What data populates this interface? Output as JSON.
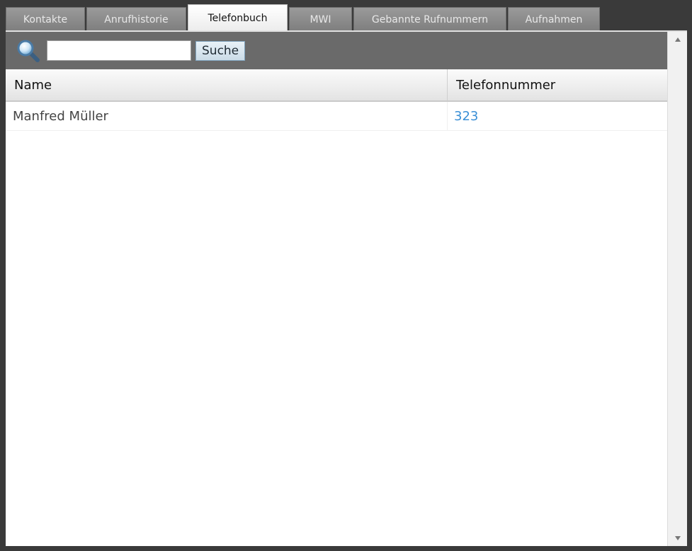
{
  "tabs": [
    {
      "label": "Kontakte",
      "active": false
    },
    {
      "label": "Anrufhistorie",
      "active": false
    },
    {
      "label": "Telefonbuch",
      "active": true
    },
    {
      "label": "MWI",
      "active": false
    },
    {
      "label": "Gebannte Rufnummern",
      "active": false
    },
    {
      "label": "Aufnahmen",
      "active": false
    }
  ],
  "toolbar": {
    "search_icon": "search-icon",
    "search_value": "",
    "search_button_label": "Suche"
  },
  "table": {
    "headers": {
      "name": "Name",
      "phone": "Telefonnummer"
    },
    "rows": [
      {
        "name": "Manfred Müller",
        "phone": "323"
      }
    ]
  },
  "colors": {
    "link": "#3a8fd6",
    "toolbar_bg": "#6a6a6a",
    "tab_inactive_bg": "#8a8a8a"
  }
}
